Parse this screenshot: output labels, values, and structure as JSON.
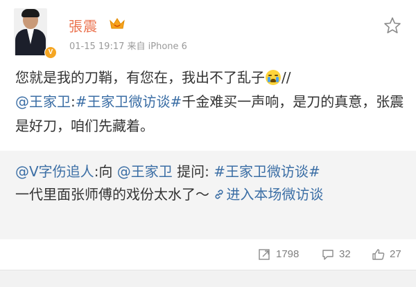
{
  "user": {
    "name": "張震",
    "timestamp": "01-15 19:17",
    "source": "来自 iPhone 6"
  },
  "post": {
    "text_part1": "您就是我的刀鞘，有您在，我出不了乱子",
    "separator": "//",
    "mention": "@王家卫",
    "colon": ":",
    "hashtag": "#王家卫微访谈#",
    "text_part2": "千金难买一声响，是刀的真意，张震是好刀，咱们先藏着。"
  },
  "retweet": {
    "author": "@V字伤追人",
    "to_label": ":向 ",
    "mention": "@王家卫",
    "ask_label": " 提问: ",
    "hashtag": "#王家卫微访谈#",
    "body": "一代里面张师傅的戏份太水了～",
    "link_text": "进入本场微访谈"
  },
  "actions": {
    "reposts": "1798",
    "comments": "32",
    "likes": "27"
  },
  "colors": {
    "username": "#eb7350",
    "link": "#3b6ea5",
    "retweet_bg": "#f4f4f4",
    "verified": "#f5a623"
  },
  "icons": [
    "verified-v-icon",
    "vip-crown-icon",
    "star-icon",
    "crying-emoji-icon",
    "link-icon",
    "repost-icon",
    "comment-icon",
    "like-icon"
  ]
}
